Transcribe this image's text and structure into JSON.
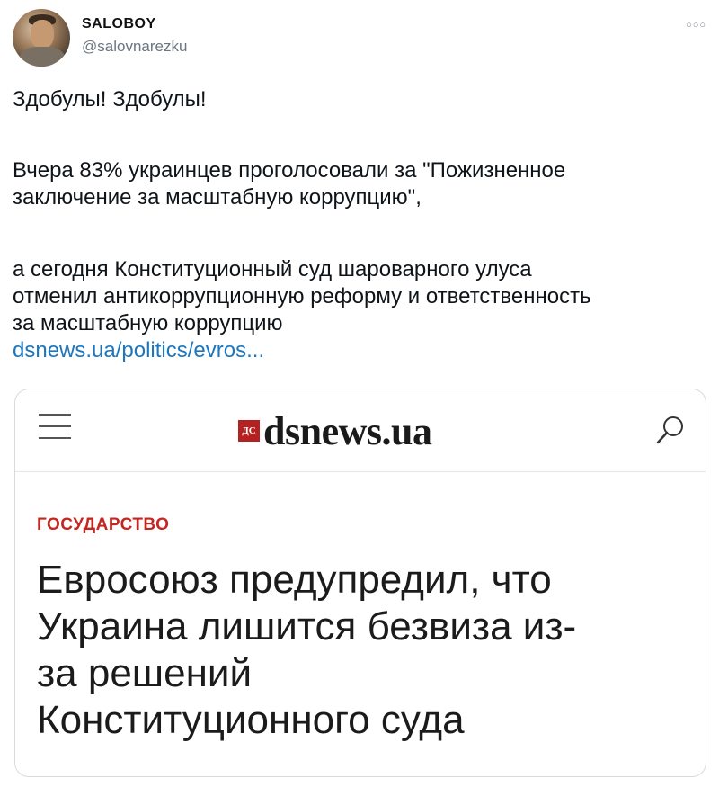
{
  "tweet": {
    "display_name": "SALOBOY",
    "handle": "@salovnarezku",
    "more_icon": "more-icon",
    "lines": [
      "Здобулы! Здобулы!",
      "Вчера 83% украинцев проголосовали за \"Пожизненное",
      "заключение за масштабную коррупцию\",",
      "а сегодня Конституционный суд шароварного улуса",
      "отменил антикоррупционную реформу и ответственность",
      "за масштабную коррупцию"
    ],
    "link": "dsnews.ua/politics/evros..."
  },
  "card": {
    "logo_mark": "ДС",
    "logo_text": "dsnews.ua",
    "section": "ГОСУДАРСТВО",
    "headline_lines": [
      "Евросоюз предупредил, что",
      "Украина лишится безвиза из-",
      "за решений",
      "Конституционного суда"
    ],
    "menu_icon": "hamburger-menu-icon",
    "search_icon": "search-icon"
  },
  "colors": {
    "link": "#1d77bf",
    "section": "#c4271f",
    "logo_mark_bg": "#b42121"
  }
}
